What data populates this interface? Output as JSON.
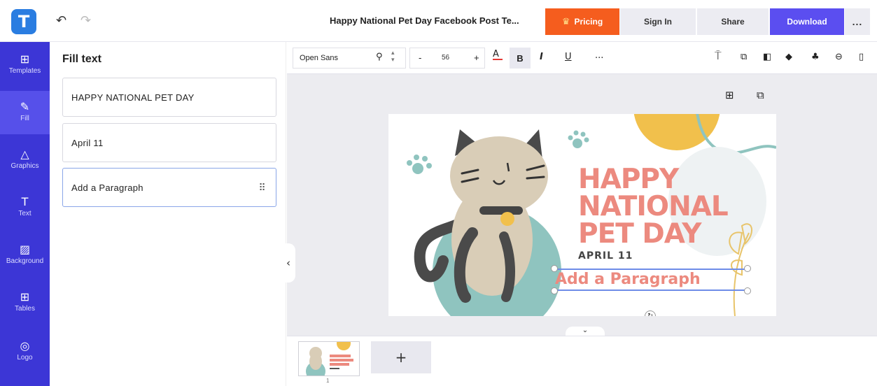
{
  "header": {
    "logo_letter": "T",
    "doc_title": "Happy National Pet Day Facebook Post Te...",
    "pricing_label": "Pricing",
    "signin_label": "Sign In",
    "share_label": "Share",
    "download_label": "Download",
    "more_label": "..."
  },
  "sidebar": {
    "items": [
      {
        "label": "Templates",
        "icon": "templates-icon"
      },
      {
        "label": "Fill",
        "icon": "pencil-icon"
      },
      {
        "label": "Graphics",
        "icon": "shapes-icon"
      },
      {
        "label": "Text",
        "icon": "text-icon"
      },
      {
        "label": "Background",
        "icon": "background-icon"
      },
      {
        "label": "Tables",
        "icon": "table-icon"
      },
      {
        "label": "Logo",
        "icon": "logo-icon"
      }
    ],
    "active": "Fill"
  },
  "fill_panel": {
    "title": "Fill text",
    "fields": [
      "HAPPY NATIONAL PET DAY",
      "April 11",
      "Add a Paragraph"
    ]
  },
  "toolbar": {
    "font_family": "Open Sans",
    "font_size": "56",
    "decrease_label": "-",
    "increase_label": "+",
    "bold_label": "B",
    "italic_label": "I",
    "underline_label": "U",
    "more_label": "..."
  },
  "design": {
    "headline_1": "HAPPY",
    "headline_2": "NATIONAL",
    "headline_3": "PET DAY",
    "date": "APRIL 11",
    "paragraph": "Add a Paragraph",
    "colors": {
      "headline": "#ec8a7f",
      "teal": "#8fc4bf",
      "sun": "#f1c04c",
      "cat": "#d9cdb7"
    }
  },
  "pages": {
    "thumb_number": "1",
    "add_label": "+"
  }
}
